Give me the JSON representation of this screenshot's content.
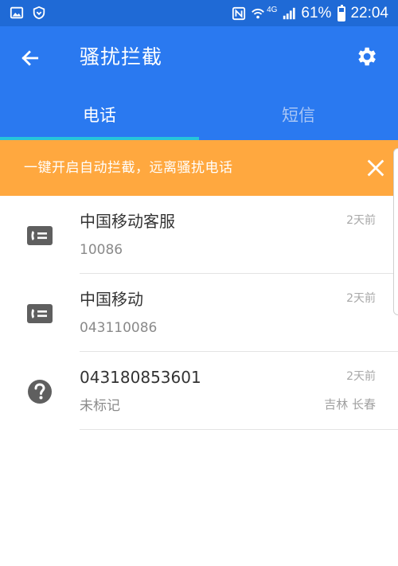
{
  "status_bar": {
    "battery": "61%",
    "time": "22:04",
    "network": "4G",
    "icons": [
      "gallery-icon",
      "shield-icon",
      "nfc-icon",
      "wifi-icon",
      "signal-icon",
      "battery-icon"
    ],
    "battery_level": 0.61
  },
  "header": {
    "title": "骚扰拦截",
    "back_icon": "arrow-left-icon",
    "settings_icon": "gear-icon"
  },
  "tabs": [
    {
      "label": "电话",
      "active": true
    },
    {
      "label": "短信",
      "active": false
    }
  ],
  "banner": {
    "text": "一键开启自动拦截，远离骚扰电话",
    "close_icon": "close-icon"
  },
  "calls": [
    {
      "name": "中国移动客服",
      "number": "10086",
      "time": "2天前",
      "location": "",
      "icon": "contact-card-icon"
    },
    {
      "name": "中国移动",
      "number": "043110086",
      "time": "2天前",
      "location": "",
      "icon": "contact-card-icon"
    },
    {
      "name": "043180853601",
      "number": "未标记",
      "time": "2天前",
      "location": "吉林 长春",
      "icon": "question-icon"
    }
  ],
  "colors": {
    "status_bar": "#1f6ad6",
    "app_bar": "#2a79f0",
    "tab_indicator": "#26c6da",
    "banner": "#ffa83f"
  }
}
